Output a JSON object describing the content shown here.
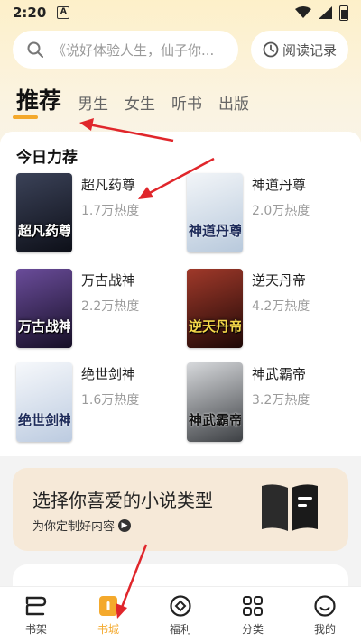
{
  "status_bar": {
    "time": "2:20",
    "notification_glyph": "A"
  },
  "search": {
    "placeholder": "《说好体验人生，仙子你..."
  },
  "history_button": {
    "label": "阅读记录"
  },
  "tabs": [
    {
      "label": "推荐",
      "active": true
    },
    {
      "label": "男生",
      "active": false
    },
    {
      "label": "女生",
      "active": false
    },
    {
      "label": "听书",
      "active": false
    },
    {
      "label": "出版",
      "active": false
    }
  ],
  "recommend": {
    "title": "今日力荐",
    "books": [
      {
        "name": "超凡药尊",
        "heat": "1.7万热度",
        "cover_text": "超凡药尊",
        "cover_color": "#1c1f2c"
      },
      {
        "name": "神道丹尊",
        "heat": "2.0万热度",
        "cover_text": "神道丹尊",
        "cover_color": "#d9e4ef"
      },
      {
        "name": "万古战神",
        "heat": "2.2万热度",
        "cover_text": "万古战神",
        "cover_color": "#2a1f44"
      },
      {
        "name": "逆天丹帝",
        "heat": "4.2万热度",
        "cover_text": "逆天丹帝",
        "cover_color": "#3a1410"
      },
      {
        "name": "绝世剑神",
        "heat": "1.6万热度",
        "cover_text": "绝世剑神",
        "cover_color": "#dfe7f2"
      },
      {
        "name": "神武霸帝",
        "heat": "3.2万热度",
        "cover_text": "神武霸帝",
        "cover_color": "#55585c"
      }
    ]
  },
  "genre_banner": {
    "title": "选择你喜爱的小说类型",
    "subtitle": "为你定制好内容"
  },
  "bottom_nav": [
    {
      "label": "书架",
      "icon": "bookshelf-icon",
      "active": false
    },
    {
      "label": "书城",
      "icon": "bookstore-icon",
      "active": true
    },
    {
      "label": "福利",
      "icon": "gift-icon",
      "active": false
    },
    {
      "label": "分类",
      "icon": "category-icon",
      "active": false
    },
    {
      "label": "我的",
      "icon": "profile-icon",
      "active": false
    }
  ],
  "colors": {
    "accent": "#f4a92c",
    "annotation_red": "#e0262b"
  }
}
